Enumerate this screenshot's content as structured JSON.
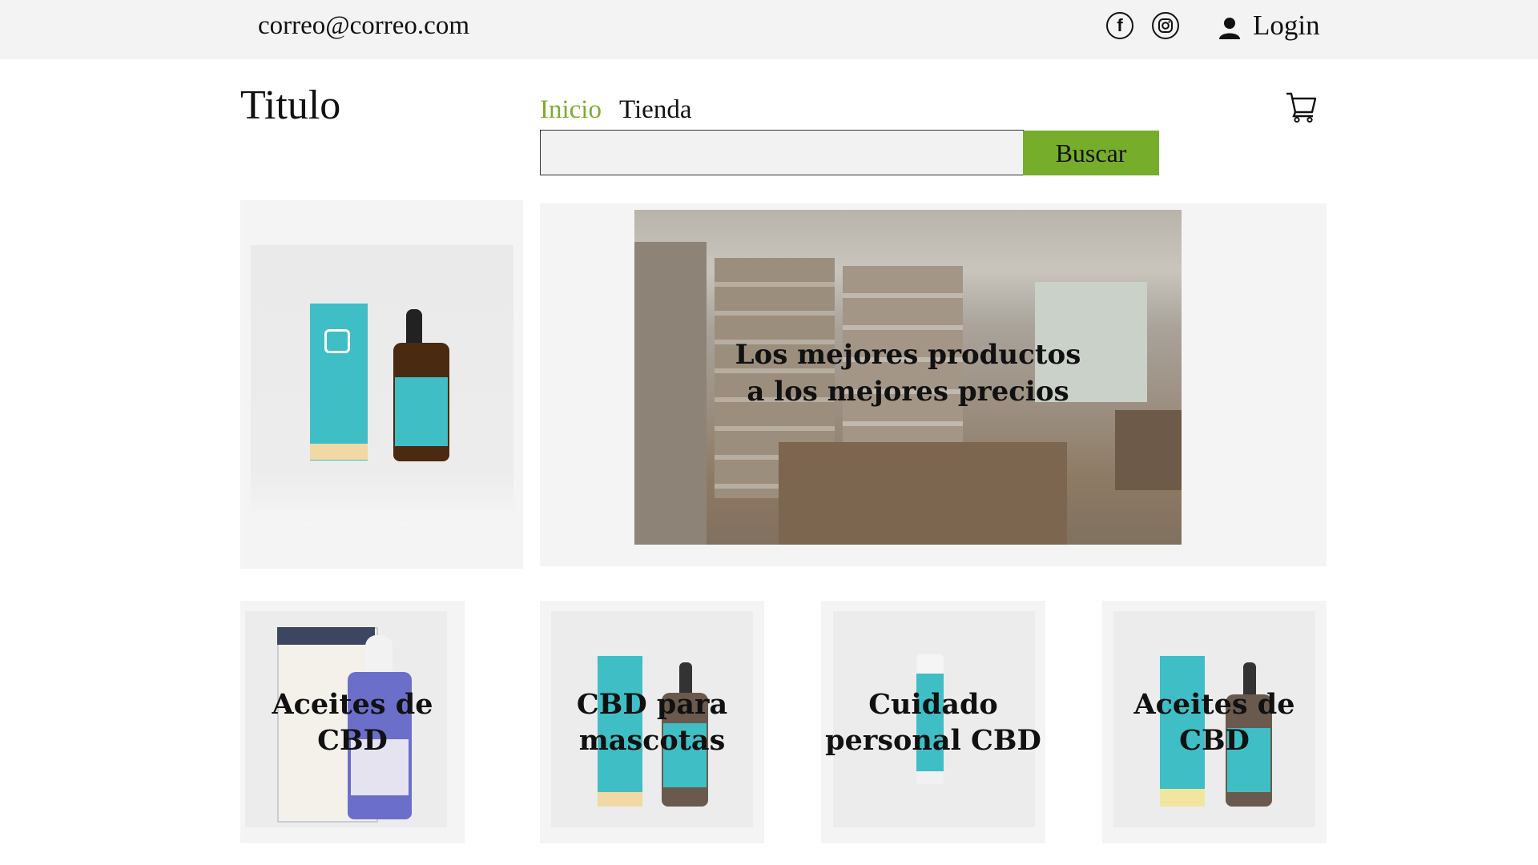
{
  "topbar": {
    "email": "correo@correo.com",
    "login_label": "Login",
    "icons": [
      "facebook-icon",
      "instagram-icon",
      "user-icon"
    ]
  },
  "header": {
    "title": "Titulo",
    "nav": [
      {
        "label": "Inicio",
        "active": true
      },
      {
        "label": "Tienda",
        "active": false
      }
    ],
    "search": {
      "value": "",
      "button_label": "Buscar"
    },
    "cart_icon": "cart-icon"
  },
  "hero": {
    "headline_line1": "Los mejores productos",
    "headline_line2": "a los mejores precios"
  },
  "categories": [
    {
      "label": "Aceites de CBD"
    },
    {
      "label": "CBD para mascotas"
    },
    {
      "label": "Cuidado personal CBD"
    },
    {
      "label": "Aceites de CBD"
    }
  ],
  "colors": {
    "accent": "#76ad2b",
    "nav_active": "#7cac2e",
    "topbar_bg": "#f3f3f3",
    "panel_bg": "#f4f4f4"
  }
}
